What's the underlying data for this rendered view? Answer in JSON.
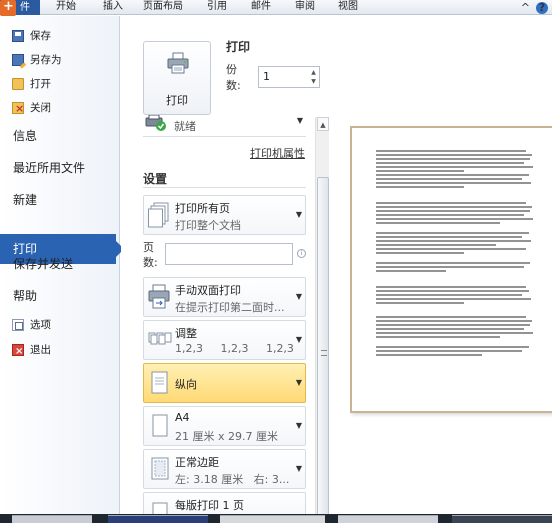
{
  "ribbon": {
    "file_tab": "件",
    "tabs": [
      "开始",
      "插入",
      "页面布局",
      "引用",
      "邮件",
      "审阅",
      "视图"
    ],
    "right_caret": "^",
    "help": "?"
  },
  "nav": {
    "save": "保存",
    "save_as": "另存为",
    "open": "打开",
    "close": "关闭",
    "info": "信息",
    "recent": "最近所用文件",
    "new": "新建",
    "print": "打印",
    "save_send": "保存并发送",
    "help": "帮助",
    "options": "选项",
    "exit": "退出"
  },
  "print": {
    "button_label": "打印",
    "heading": "打印",
    "copies_label": "份数:",
    "copies_value": "1",
    "printer_status": "就绪",
    "printer_properties": "打印机属性",
    "settings_heading": "设置",
    "pages_label": "页数:",
    "pages_value": ""
  },
  "settings": [
    {
      "title": "打印所有页",
      "sub": "打印整个文档",
      "icon": "pages-icon"
    },
    {
      "title": "手动双面打印",
      "sub": "在提示打印第二面时...",
      "icon": "duplex-print-icon"
    },
    {
      "title": "调整",
      "sub": "1,2,3     1,2,3     1,2,3",
      "icon": "collate-icon"
    },
    {
      "title": "纵向",
      "sub": "",
      "icon": "portrait-icon"
    },
    {
      "title": "A4",
      "sub": "21 厘米 x 29.7 厘米",
      "icon": "paper-size-icon"
    },
    {
      "title": "正常边距",
      "sub": "左: 3.18 厘米   右: 3...",
      "icon": "margins-icon"
    },
    {
      "title": "每版打印 1 页",
      "sub": "",
      "icon": "pages-per-sheet-icon"
    }
  ],
  "colors": {
    "active_nav": "#2b63b3",
    "highlight": "#ffd975",
    "page_border": "#c8b392"
  }
}
